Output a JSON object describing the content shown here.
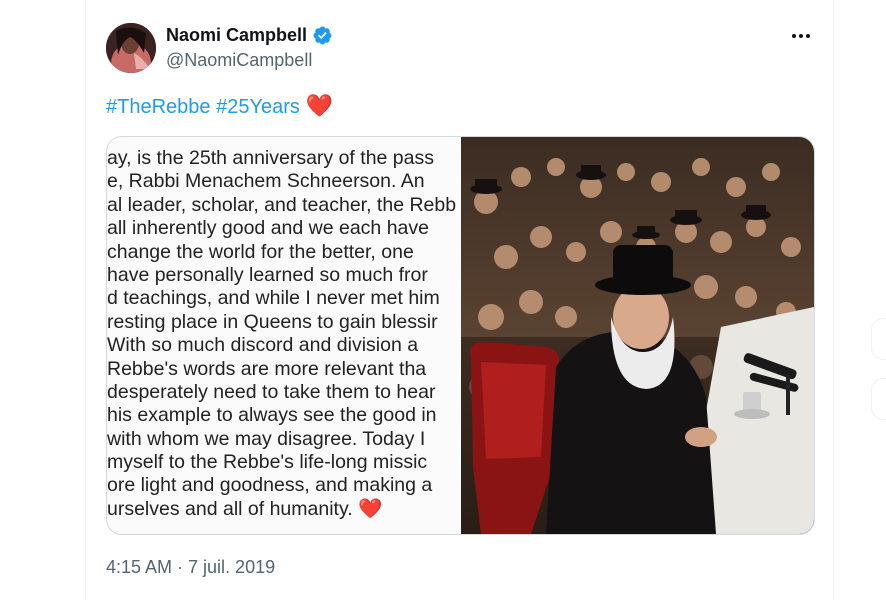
{
  "tweet": {
    "author": {
      "display_name": "Naomi Campbell",
      "handle": "@NaomiCampbell",
      "verified": true
    },
    "text": {
      "hashtags": [
        "#TheRebbe",
        "#25Years"
      ],
      "emoji": "❤️"
    },
    "media": {
      "statement_lines": [
        "ay, is the 25th anniversary of the pass",
        "e, Rabbi Menachem Schneerson.  An",
        "al leader, scholar, and teacher, the Rebb",
        " all inherently good and we each have",
        " change the world for the better, one",
        " have personally learned so much fror",
        "d teachings, and while I never met him",
        "resting place in Queens to gain blessir",
        " With so much discord and division a",
        "Rebbe's words are more relevant tha",
        "desperately need to take them to hear",
        "his example to always see the good in",
        " with whom we may disagree.  Today I",
        "myself to the Rebbe's life-long missic",
        "ore light and goodness, and making a",
        "urselves and all of humanity. ❤️"
      ]
    },
    "timestamp": "4:15 AM · 7 juil. 2019",
    "more_icon": "more-horizontal-icon"
  },
  "colors": {
    "accent": "#1d9bf0",
    "text_primary": "#0f1419",
    "text_secondary": "#536471",
    "heart": "#d0021b",
    "border": "#cfd9de"
  }
}
